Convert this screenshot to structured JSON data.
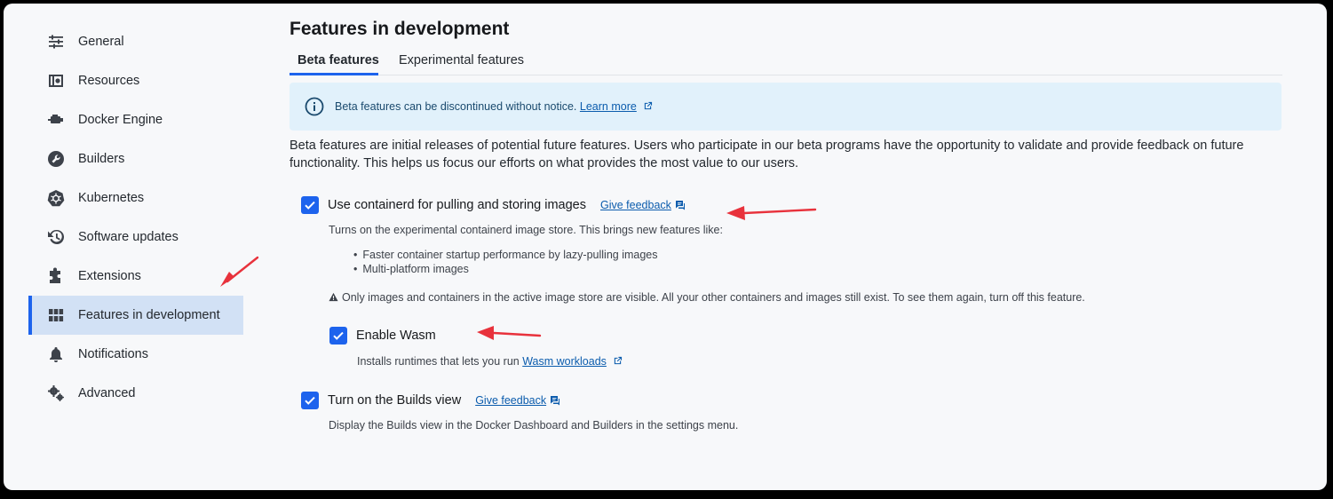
{
  "sidebar": {
    "items": [
      {
        "label": "General",
        "icon": "sliders-icon"
      },
      {
        "label": "Resources",
        "icon": "resources-icon"
      },
      {
        "label": "Docker Engine",
        "icon": "engine-icon"
      },
      {
        "label": "Builders",
        "icon": "wrench-icon"
      },
      {
        "label": "Kubernetes",
        "icon": "kubernetes-icon"
      },
      {
        "label": "Software updates",
        "icon": "history-icon"
      },
      {
        "label": "Extensions",
        "icon": "puzzle-icon"
      },
      {
        "label": "Features in development",
        "icon": "grid-icon",
        "active": true
      },
      {
        "label": "Notifications",
        "icon": "bell-icon"
      },
      {
        "label": "Advanced",
        "icon": "gears-icon"
      }
    ]
  },
  "main": {
    "title": "Features in development",
    "tabs": [
      {
        "label": "Beta features",
        "active": true
      },
      {
        "label": "Experimental features"
      }
    ],
    "banner": {
      "text": "Beta features can be discontinued without notice.",
      "link": "Learn more"
    },
    "description": "Beta features are initial releases of potential future features. Users who participate in our beta programs have the opportunity to validate and provide feedback on future functionality. This helps us focus our efforts on what provides the most value to our users.",
    "features": {
      "containerd": {
        "label": "Use containerd for pulling and storing images",
        "checked": true,
        "feedback": "Give feedback",
        "description": "Turns on the experimental containerd image store. This brings new features like:",
        "bullets": [
          "Faster container startup performance by lazy-pulling images",
          "Multi-platform images"
        ],
        "warning": "Only images and containers in the active image store are visible. All your other containers and images still exist. To see them again, turn off this feature."
      },
      "wasm": {
        "label": "Enable Wasm",
        "checked": true,
        "description": "Installs runtimes that lets you run",
        "link": "Wasm workloads"
      },
      "builds": {
        "label": "Turn on the Builds view",
        "checked": true,
        "feedback": "Give feedback",
        "description": "Display the Builds view in the Docker Dashboard and Builders in the settings menu."
      }
    }
  },
  "colors": {
    "accent": "#1d63ed",
    "active_bg": "#d2e1f5",
    "banner_bg": "#e1f1fb",
    "annotation_arrow": "#e8323c"
  }
}
